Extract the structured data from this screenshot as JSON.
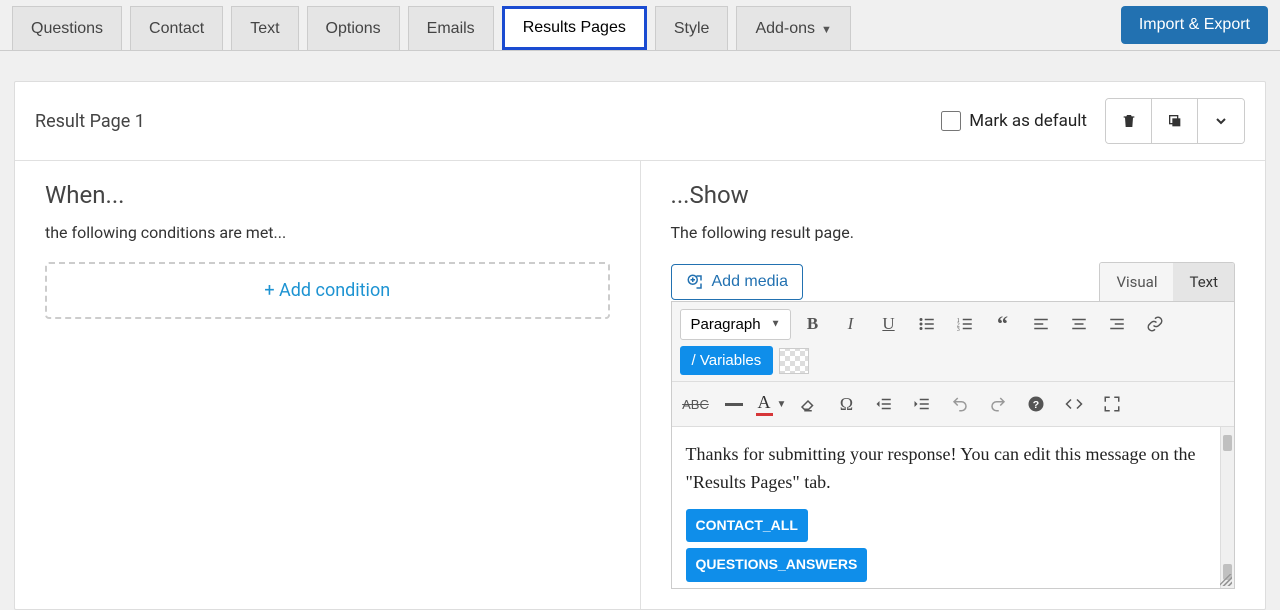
{
  "tabs": {
    "items": [
      "Questions",
      "Contact",
      "Text",
      "Options",
      "Emails",
      "Results Pages",
      "Style",
      "Add-ons"
    ],
    "active_index": 5,
    "addons_caret": "▼"
  },
  "import_export_label": "Import & Export",
  "result_page": {
    "title": "Result Page 1",
    "mark_default_label": "Mark as default",
    "mark_default_checked": false
  },
  "left": {
    "heading": "When...",
    "subtitle": "the following conditions are met...",
    "add_condition_label": "+ Add condition"
  },
  "right": {
    "heading": "...Show",
    "subtitle": "The following result page.",
    "add_media_label": "Add media",
    "editor_tabs": {
      "visual": "Visual",
      "text": "Text",
      "active": "text"
    },
    "format_dropdown": "Paragraph",
    "variables_button": "/ Variables",
    "body_text": "Thanks for submitting your response! You can edit this message on the \"Results Pages\" tab.",
    "chips": [
      "CONTACT_ALL",
      "QUESTIONS_ANSWERS"
    ]
  },
  "colors": {
    "primary_blue": "#2271b1",
    "active_tab_border": "#1a4bd1",
    "link_blue": "#1d93d2",
    "chip_blue": "#0f8eea"
  }
}
